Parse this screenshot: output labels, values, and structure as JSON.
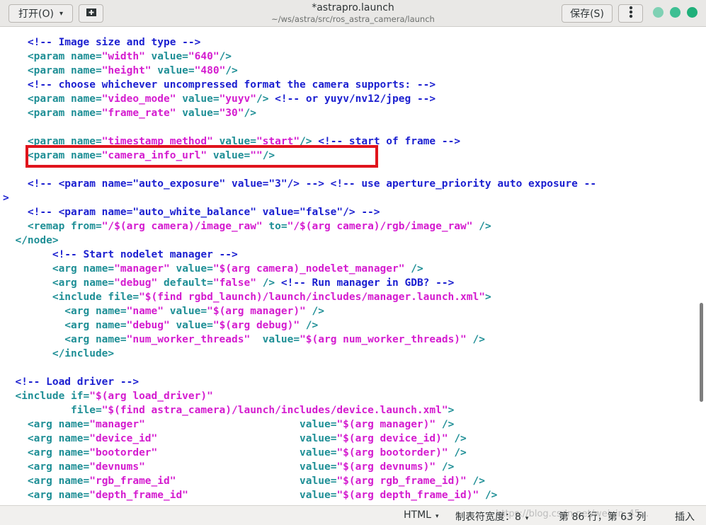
{
  "header": {
    "open_label": "打开(O)",
    "open_chevron": "▾",
    "new_tab_icon": "new-tab-icon",
    "title": "*astrapro.launch",
    "subtitle": "~/ws/astra/src/ros_astra_camera/launch",
    "save_label": "保存(S)",
    "menu_icon": "hamburger-menu-icon",
    "window_buttons": [
      {
        "name": "minimize",
        "color": "#7fd1b4"
      },
      {
        "name": "maximize",
        "color": "#3dbf93"
      },
      {
        "name": "close",
        "color": "#1fb07a"
      }
    ]
  },
  "editor": {
    "lines": [
      [
        [
          "c",
          "    <!-- Image size and type -->"
        ]
      ],
      [
        [
          "t",
          "    <param "
        ],
        [
          "a",
          "name="
        ],
        [
          "s",
          "\"width\" "
        ],
        [
          "a",
          "value="
        ],
        [
          "s",
          "\"640\""
        ],
        [
          "t",
          "/>"
        ]
      ],
      [
        [
          "t",
          "    <param "
        ],
        [
          "a",
          "name="
        ],
        [
          "s",
          "\"height\" "
        ],
        [
          "a",
          "value="
        ],
        [
          "s",
          "\"480\""
        ],
        [
          "t",
          "/>"
        ]
      ],
      [
        [
          "c",
          "    <!-- choose whichever uncompressed format the camera supports: -->"
        ]
      ],
      [
        [
          "t",
          "    <param "
        ],
        [
          "a",
          "name="
        ],
        [
          "s",
          "\"video_mode\" "
        ],
        [
          "a",
          "value="
        ],
        [
          "s",
          "\"yuyv\""
        ],
        [
          "t",
          "/> "
        ],
        [
          "c",
          "<!-- or yuyv/nv12/jpeg -->"
        ]
      ],
      [
        [
          "t",
          "    <param "
        ],
        [
          "a",
          "name="
        ],
        [
          "s",
          "\"frame_rate\" "
        ],
        [
          "a",
          "value="
        ],
        [
          "s",
          "\"30\""
        ],
        [
          "t",
          "/>"
        ]
      ],
      [
        [
          "t",
          ""
        ]
      ],
      [
        [
          "t",
          "    <param "
        ],
        [
          "a",
          "name="
        ],
        [
          "s",
          "\"timestamp_method\" "
        ],
        [
          "a",
          "value="
        ],
        [
          "s",
          "\"start\""
        ],
        [
          "t",
          "/> "
        ],
        [
          "c",
          "<!-- start of frame -->"
        ]
      ],
      [
        [
          "t",
          "    <param "
        ],
        [
          "a",
          "name="
        ],
        [
          "s",
          "\"camera_info_url\" "
        ],
        [
          "a",
          "value="
        ],
        [
          "s",
          "\"\""
        ],
        [
          "t",
          "/>"
        ]
      ],
      [
        [
          "t",
          ""
        ]
      ],
      [
        [
          "c",
          "    <!-- <param name=\"auto_exposure\" value=\"3\"/> --> <!-- use aperture_priority auto exposure --"
        ]
      ],
      [
        [
          "c",
          ">"
        ]
      ],
      [
        [
          "c",
          "    <!-- <param name=\"auto_white_balance\" value=\"false\"/> -->"
        ]
      ],
      [
        [
          "t",
          "    <remap "
        ],
        [
          "a",
          "from="
        ],
        [
          "s",
          "\"/$(arg camera)/image_raw\" "
        ],
        [
          "a",
          "to="
        ],
        [
          "s",
          "\"/$(arg camera)/rgb/image_raw\" "
        ],
        [
          "t",
          "/>"
        ]
      ],
      [
        [
          "t",
          "  </node>"
        ]
      ],
      [
        [
          "c",
          "        <!-- Start nodelet manager -->"
        ]
      ],
      [
        [
          "t",
          "        <arg "
        ],
        [
          "a",
          "name="
        ],
        [
          "s",
          "\"manager\" "
        ],
        [
          "a",
          "value="
        ],
        [
          "s",
          "\"$(arg camera)_nodelet_manager\" "
        ],
        [
          "t",
          "/>"
        ]
      ],
      [
        [
          "t",
          "        <arg "
        ],
        [
          "a",
          "name="
        ],
        [
          "s",
          "\"debug\" "
        ],
        [
          "a",
          "default="
        ],
        [
          "s",
          "\"false\" "
        ],
        [
          "t",
          "/> "
        ],
        [
          "c",
          "<!-- Run manager in GDB? -->"
        ]
      ],
      [
        [
          "t",
          "        <include "
        ],
        [
          "a",
          "file="
        ],
        [
          "s",
          "\"$(find rgbd_launch)/launch/includes/manager.launch.xml\""
        ],
        [
          "t",
          ">"
        ]
      ],
      [
        [
          "t",
          "          <arg "
        ],
        [
          "a",
          "name="
        ],
        [
          "s",
          "\"name\" "
        ],
        [
          "a",
          "value="
        ],
        [
          "s",
          "\"$(arg manager)\" "
        ],
        [
          "t",
          "/>"
        ]
      ],
      [
        [
          "t",
          "          <arg "
        ],
        [
          "a",
          "name="
        ],
        [
          "s",
          "\"debug\" "
        ],
        [
          "a",
          "value="
        ],
        [
          "s",
          "\"$(arg debug)\" "
        ],
        [
          "t",
          "/>"
        ]
      ],
      [
        [
          "t",
          "          <arg "
        ],
        [
          "a",
          "name="
        ],
        [
          "s",
          "\"num_worker_threads\"  "
        ],
        [
          "a",
          "value="
        ],
        [
          "s",
          "\"$(arg num_worker_threads)\" "
        ],
        [
          "t",
          "/>"
        ]
      ],
      [
        [
          "t",
          "        </include>"
        ]
      ],
      [
        [
          "t",
          ""
        ]
      ],
      [
        [
          "c",
          "  <!-- Load driver -->"
        ]
      ],
      [
        [
          "t",
          "  <include "
        ],
        [
          "a",
          "if="
        ],
        [
          "s",
          "\"$(arg load_driver)\""
        ]
      ],
      [
        [
          "a",
          "           file="
        ],
        [
          "s",
          "\"$(find astra_camera)/launch/includes/device.launch.xml\""
        ],
        [
          "t",
          ">"
        ]
      ],
      [
        [
          "t",
          "    <arg "
        ],
        [
          "a",
          "name="
        ],
        [
          "s",
          "\"manager\"                         "
        ],
        [
          "a",
          "value="
        ],
        [
          "s",
          "\"$(arg manager)\" "
        ],
        [
          "t",
          "/>"
        ]
      ],
      [
        [
          "t",
          "    <arg "
        ],
        [
          "a",
          "name="
        ],
        [
          "s",
          "\"device_id\"                       "
        ],
        [
          "a",
          "value="
        ],
        [
          "s",
          "\"$(arg device_id)\" "
        ],
        [
          "t",
          "/>"
        ]
      ],
      [
        [
          "t",
          "    <arg "
        ],
        [
          "a",
          "name="
        ],
        [
          "s",
          "\"bootorder\"                       "
        ],
        [
          "a",
          "value="
        ],
        [
          "s",
          "\"$(arg bootorder)\" "
        ],
        [
          "t",
          "/>"
        ]
      ],
      [
        [
          "t",
          "    <arg "
        ],
        [
          "a",
          "name="
        ],
        [
          "s",
          "\"devnums\"                         "
        ],
        [
          "a",
          "value="
        ],
        [
          "s",
          "\"$(arg devnums)\" "
        ],
        [
          "t",
          "/>"
        ]
      ],
      [
        [
          "t",
          "    <arg "
        ],
        [
          "a",
          "name="
        ],
        [
          "s",
          "\"rgb_frame_id\"                    "
        ],
        [
          "a",
          "value="
        ],
        [
          "s",
          "\"$(arg rgb_frame_id)\" "
        ],
        [
          "t",
          "/>"
        ]
      ],
      [
        [
          "t",
          "    <arg "
        ],
        [
          "a",
          "name="
        ],
        [
          "s",
          "\"depth_frame_id\"                  "
        ],
        [
          "a",
          "value="
        ],
        [
          "s",
          "\"$(arg depth_frame_id)\" "
        ],
        [
          "t",
          "/>"
        ]
      ]
    ]
  },
  "statusbar": {
    "language": "HTML",
    "tab_width_label": "制表符宽度：8",
    "position": "第 86 行，第 63 列",
    "mode": "插入",
    "chevron": "▾",
    "watermark": "https://blog.csdn.net/weixin_45..."
  },
  "colors": {
    "highlight_box": "#e0141c",
    "tag": "#1f8f96",
    "string": "#d41ccf",
    "comment": "#1b1fd0"
  }
}
